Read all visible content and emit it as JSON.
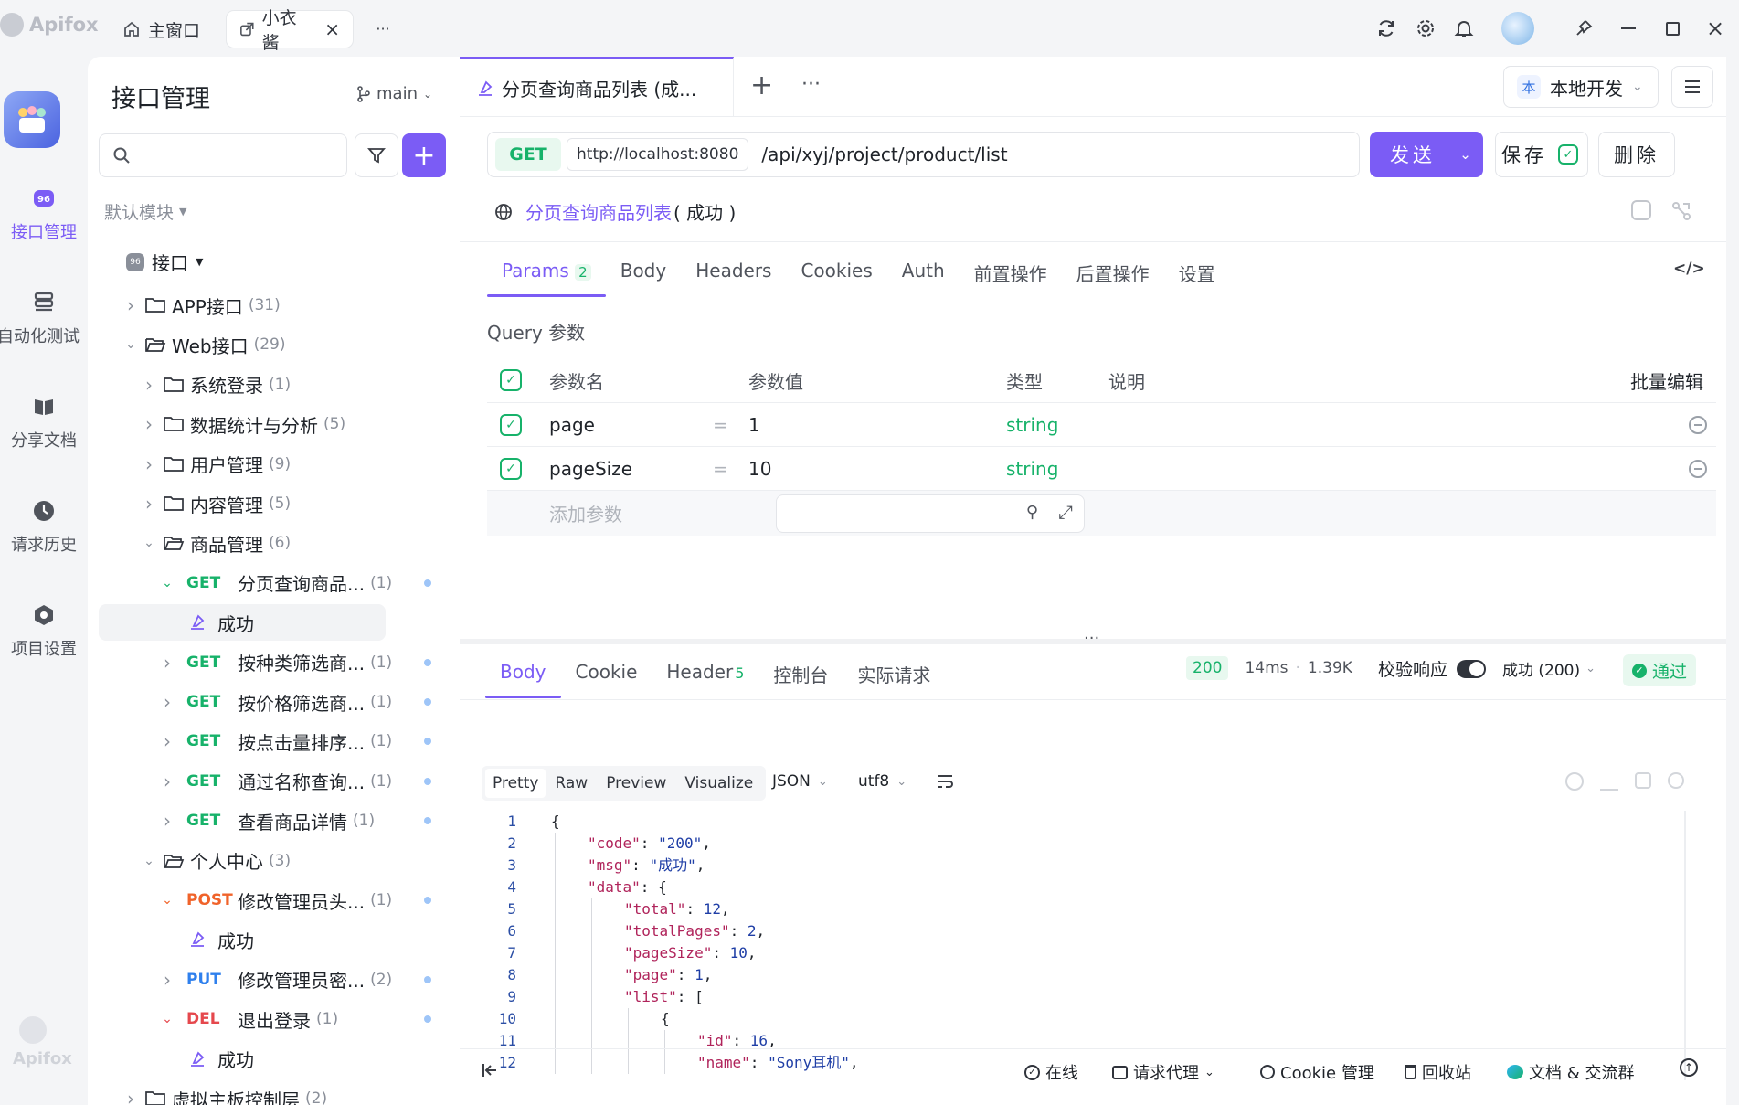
{
  "app": {
    "name": "Apifox"
  },
  "window_tabs": [
    {
      "label": "主窗口"
    },
    {
      "label": "小衣酱"
    }
  ],
  "rail": [
    {
      "label": "接口管理"
    },
    {
      "label": "自动化测试"
    },
    {
      "label": "分享文档"
    },
    {
      "label": "请求历史"
    },
    {
      "label": "项目设置"
    }
  ],
  "sidebar": {
    "title": "接口管理",
    "branch": "main",
    "module": "默认模块",
    "root": "接口",
    "tree": [
      {
        "kind": "folder",
        "label": "APP接口",
        "count": "(31)",
        "level": 1,
        "open": false
      },
      {
        "kind": "folder",
        "label": "Web接口",
        "count": "(29)",
        "level": 1,
        "open": true
      },
      {
        "kind": "folder",
        "label": "系统登录",
        "count": "(1)",
        "level": 2,
        "open": false
      },
      {
        "kind": "folder",
        "label": "数据统计与分析",
        "count": "(5)",
        "level": 2,
        "open": false
      },
      {
        "kind": "folder",
        "label": "用户管理",
        "count": "(9)",
        "level": 2,
        "open": false
      },
      {
        "kind": "folder",
        "label": "内容管理",
        "count": "(5)",
        "level": 2,
        "open": false
      },
      {
        "kind": "folder",
        "label": "商品管理",
        "count": "(6)",
        "level": 2,
        "open": true
      },
      {
        "kind": "api",
        "method": "GET",
        "label": "分页查询商品...",
        "count": "(1)",
        "level": 3,
        "open": true
      },
      {
        "kind": "case",
        "label": "成功",
        "level": 4,
        "selected": true
      },
      {
        "kind": "api",
        "method": "GET",
        "label": "按种类筛选商...",
        "count": "(1)",
        "level": 3,
        "open": false
      },
      {
        "kind": "api",
        "method": "GET",
        "label": "按价格筛选商...",
        "count": "(1)",
        "level": 3,
        "open": false
      },
      {
        "kind": "api",
        "method": "GET",
        "label": "按点击量排序...",
        "count": "(1)",
        "level": 3,
        "open": false
      },
      {
        "kind": "api",
        "method": "GET",
        "label": "通过名称查询...",
        "count": "(1)",
        "level": 3,
        "open": false
      },
      {
        "kind": "api",
        "method": "GET",
        "label": "查看商品详情",
        "count": "(1)",
        "level": 3,
        "open": false
      },
      {
        "kind": "folder",
        "label": "个人中心",
        "count": "(3)",
        "level": 2,
        "open": true
      },
      {
        "kind": "api",
        "method": "POST",
        "label": "修改管理员头...",
        "count": "(1)",
        "level": 3,
        "open": true
      },
      {
        "kind": "case",
        "label": "成功",
        "level": 4,
        "selected": false
      },
      {
        "kind": "api",
        "method": "PUT",
        "label": "修改管理员密...",
        "count": "(2)",
        "level": 3,
        "open": false
      },
      {
        "kind": "api",
        "method": "DEL",
        "label": "退出登录",
        "count": "(1)",
        "level": 3,
        "open": true
      },
      {
        "kind": "case",
        "label": "成功",
        "level": 4,
        "selected": false
      },
      {
        "kind": "folder",
        "label": "虚拟主板控制层",
        "count": "(2)",
        "level": 1,
        "open": false
      }
    ]
  },
  "doc_tab": {
    "label": "分页查询商品列表 (成..."
  },
  "environment": {
    "badge": "本",
    "label": "本地开发"
  },
  "request": {
    "method": "GET",
    "base_url": "http://localhost:8080",
    "path": "/api/xyj/project/product/list",
    "send": "发送",
    "save": "保存",
    "delete": "删除",
    "name": "分页查询商品列表",
    "case_suffix": "( 成功 )"
  },
  "req_tabs": [
    {
      "label": "Params",
      "badge": "2"
    },
    {
      "label": "Body"
    },
    {
      "label": "Headers"
    },
    {
      "label": "Cookies"
    },
    {
      "label": "Auth"
    },
    {
      "label": "前置操作"
    },
    {
      "label": "后置操作"
    },
    {
      "label": "设置"
    }
  ],
  "query": {
    "title": "Query 参数",
    "headers": {
      "name": "参数名",
      "value": "参数值",
      "type": "类型",
      "desc": "说明",
      "bulk": "批量编辑"
    },
    "rows": [
      {
        "name": "page",
        "value": "1",
        "type": "string"
      },
      {
        "name": "pageSize",
        "value": "10",
        "type": "string"
      }
    ],
    "add_placeholder": "添加参数",
    "eq": "="
  },
  "resp_tabs": [
    {
      "label": "Body"
    },
    {
      "label": "Cookie"
    },
    {
      "label": "Header",
      "badge": "5"
    },
    {
      "label": "控制台"
    },
    {
      "label": "实际请求"
    }
  ],
  "resp_meta": {
    "status": "200",
    "time": "14ms",
    "size": "1.39K",
    "validate": "校验响应",
    "result": "成功 (200)",
    "pass": "通过"
  },
  "format_tabs": [
    "Pretty",
    "Raw",
    "Preview",
    "Visualize"
  ],
  "format": {
    "lang": "JSON",
    "encoding": "utf8"
  },
  "code_lines": [
    {
      "n": "1",
      "indent": 0,
      "parts": [
        [
          "pun",
          "{"
        ]
      ]
    },
    {
      "n": "2",
      "indent": 1,
      "parts": [
        [
          "key",
          "\"code\""
        ],
        [
          "pun",
          ": "
        ],
        [
          "str",
          "\"200\""
        ],
        [
          "pun",
          ","
        ]
      ]
    },
    {
      "n": "3",
      "indent": 1,
      "parts": [
        [
          "key",
          "\"msg\""
        ],
        [
          "pun",
          ": "
        ],
        [
          "str",
          "\"成功\""
        ],
        [
          "pun",
          ","
        ]
      ]
    },
    {
      "n": "4",
      "indent": 1,
      "parts": [
        [
          "key",
          "\"data\""
        ],
        [
          "pun",
          ": {"
        ]
      ]
    },
    {
      "n": "5",
      "indent": 2,
      "parts": [
        [
          "key",
          "\"total\""
        ],
        [
          "pun",
          ": "
        ],
        [
          "num",
          "12"
        ],
        [
          "pun",
          ","
        ]
      ]
    },
    {
      "n": "6",
      "indent": 2,
      "parts": [
        [
          "key",
          "\"totalPages\""
        ],
        [
          "pun",
          ": "
        ],
        [
          "num",
          "2"
        ],
        [
          "pun",
          ","
        ]
      ]
    },
    {
      "n": "7",
      "indent": 2,
      "parts": [
        [
          "key",
          "\"pageSize\""
        ],
        [
          "pun",
          ": "
        ],
        [
          "num",
          "10"
        ],
        [
          "pun",
          ","
        ]
      ]
    },
    {
      "n": "8",
      "indent": 2,
      "parts": [
        [
          "key",
          "\"page\""
        ],
        [
          "pun",
          ": "
        ],
        [
          "num",
          "1"
        ],
        [
          "pun",
          ","
        ]
      ]
    },
    {
      "n": "9",
      "indent": 2,
      "parts": [
        [
          "key",
          "\"list\""
        ],
        [
          "pun",
          ": ["
        ]
      ]
    },
    {
      "n": "10",
      "indent": 3,
      "parts": [
        [
          "pun",
          "{"
        ]
      ]
    },
    {
      "n": "11",
      "indent": 4,
      "parts": [
        [
          "key",
          "\"id\""
        ],
        [
          "pun",
          ": "
        ],
        [
          "num",
          "16"
        ],
        [
          "pun",
          ","
        ]
      ]
    },
    {
      "n": "12",
      "indent": 4,
      "parts": [
        [
          "key",
          "\"name\""
        ],
        [
          "pun",
          ": "
        ],
        [
          "str",
          "\"Sony耳机\""
        ],
        [
          "pun",
          ","
        ]
      ]
    }
  ],
  "footer": {
    "online": "在线",
    "proxy": "请求代理",
    "cookie": "Cookie 管理",
    "trash": "回收站",
    "docs": "文档 & 交流群"
  },
  "colors": {
    "accent": "#7b5cf5",
    "get": "#17b26a",
    "post": "#f0632a",
    "put": "#2f80ed",
    "del": "#e5484d"
  }
}
